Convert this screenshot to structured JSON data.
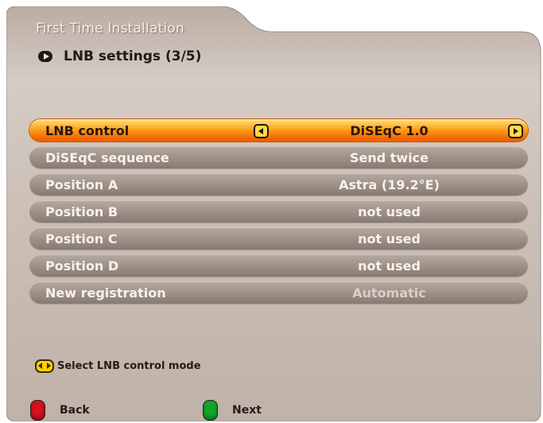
{
  "header": {
    "title": "First Time Installation",
    "subtitle": "LNB settings (3/5)",
    "subtitle_icon": "arrow-icon"
  },
  "menu": {
    "rows": [
      {
        "label": "LNB control",
        "value": "DiSEqC 1.0",
        "active": true
      },
      {
        "label": "DiSEqC sequence",
        "value": "Send twice"
      },
      {
        "label": "Position A",
        "value": "Astra (19.2°E)"
      },
      {
        "label": "Position B",
        "value": "not used"
      },
      {
        "label": "Position C",
        "value": "not used"
      },
      {
        "label": "Position D",
        "value": "not used"
      },
      {
        "label": "New registration",
        "value": "Automatic",
        "disabled": true
      }
    ]
  },
  "hint": {
    "icon": "left-right-nav-icon",
    "text": "Select LNB control mode"
  },
  "footer": {
    "back_label": "Back",
    "next_label": "Next",
    "back_color": "#d8101a",
    "next_color": "#12a52a"
  },
  "colors": {
    "panel": "#c9bdb3",
    "active_row": "#ff8a00",
    "row": "#9f928a"
  }
}
